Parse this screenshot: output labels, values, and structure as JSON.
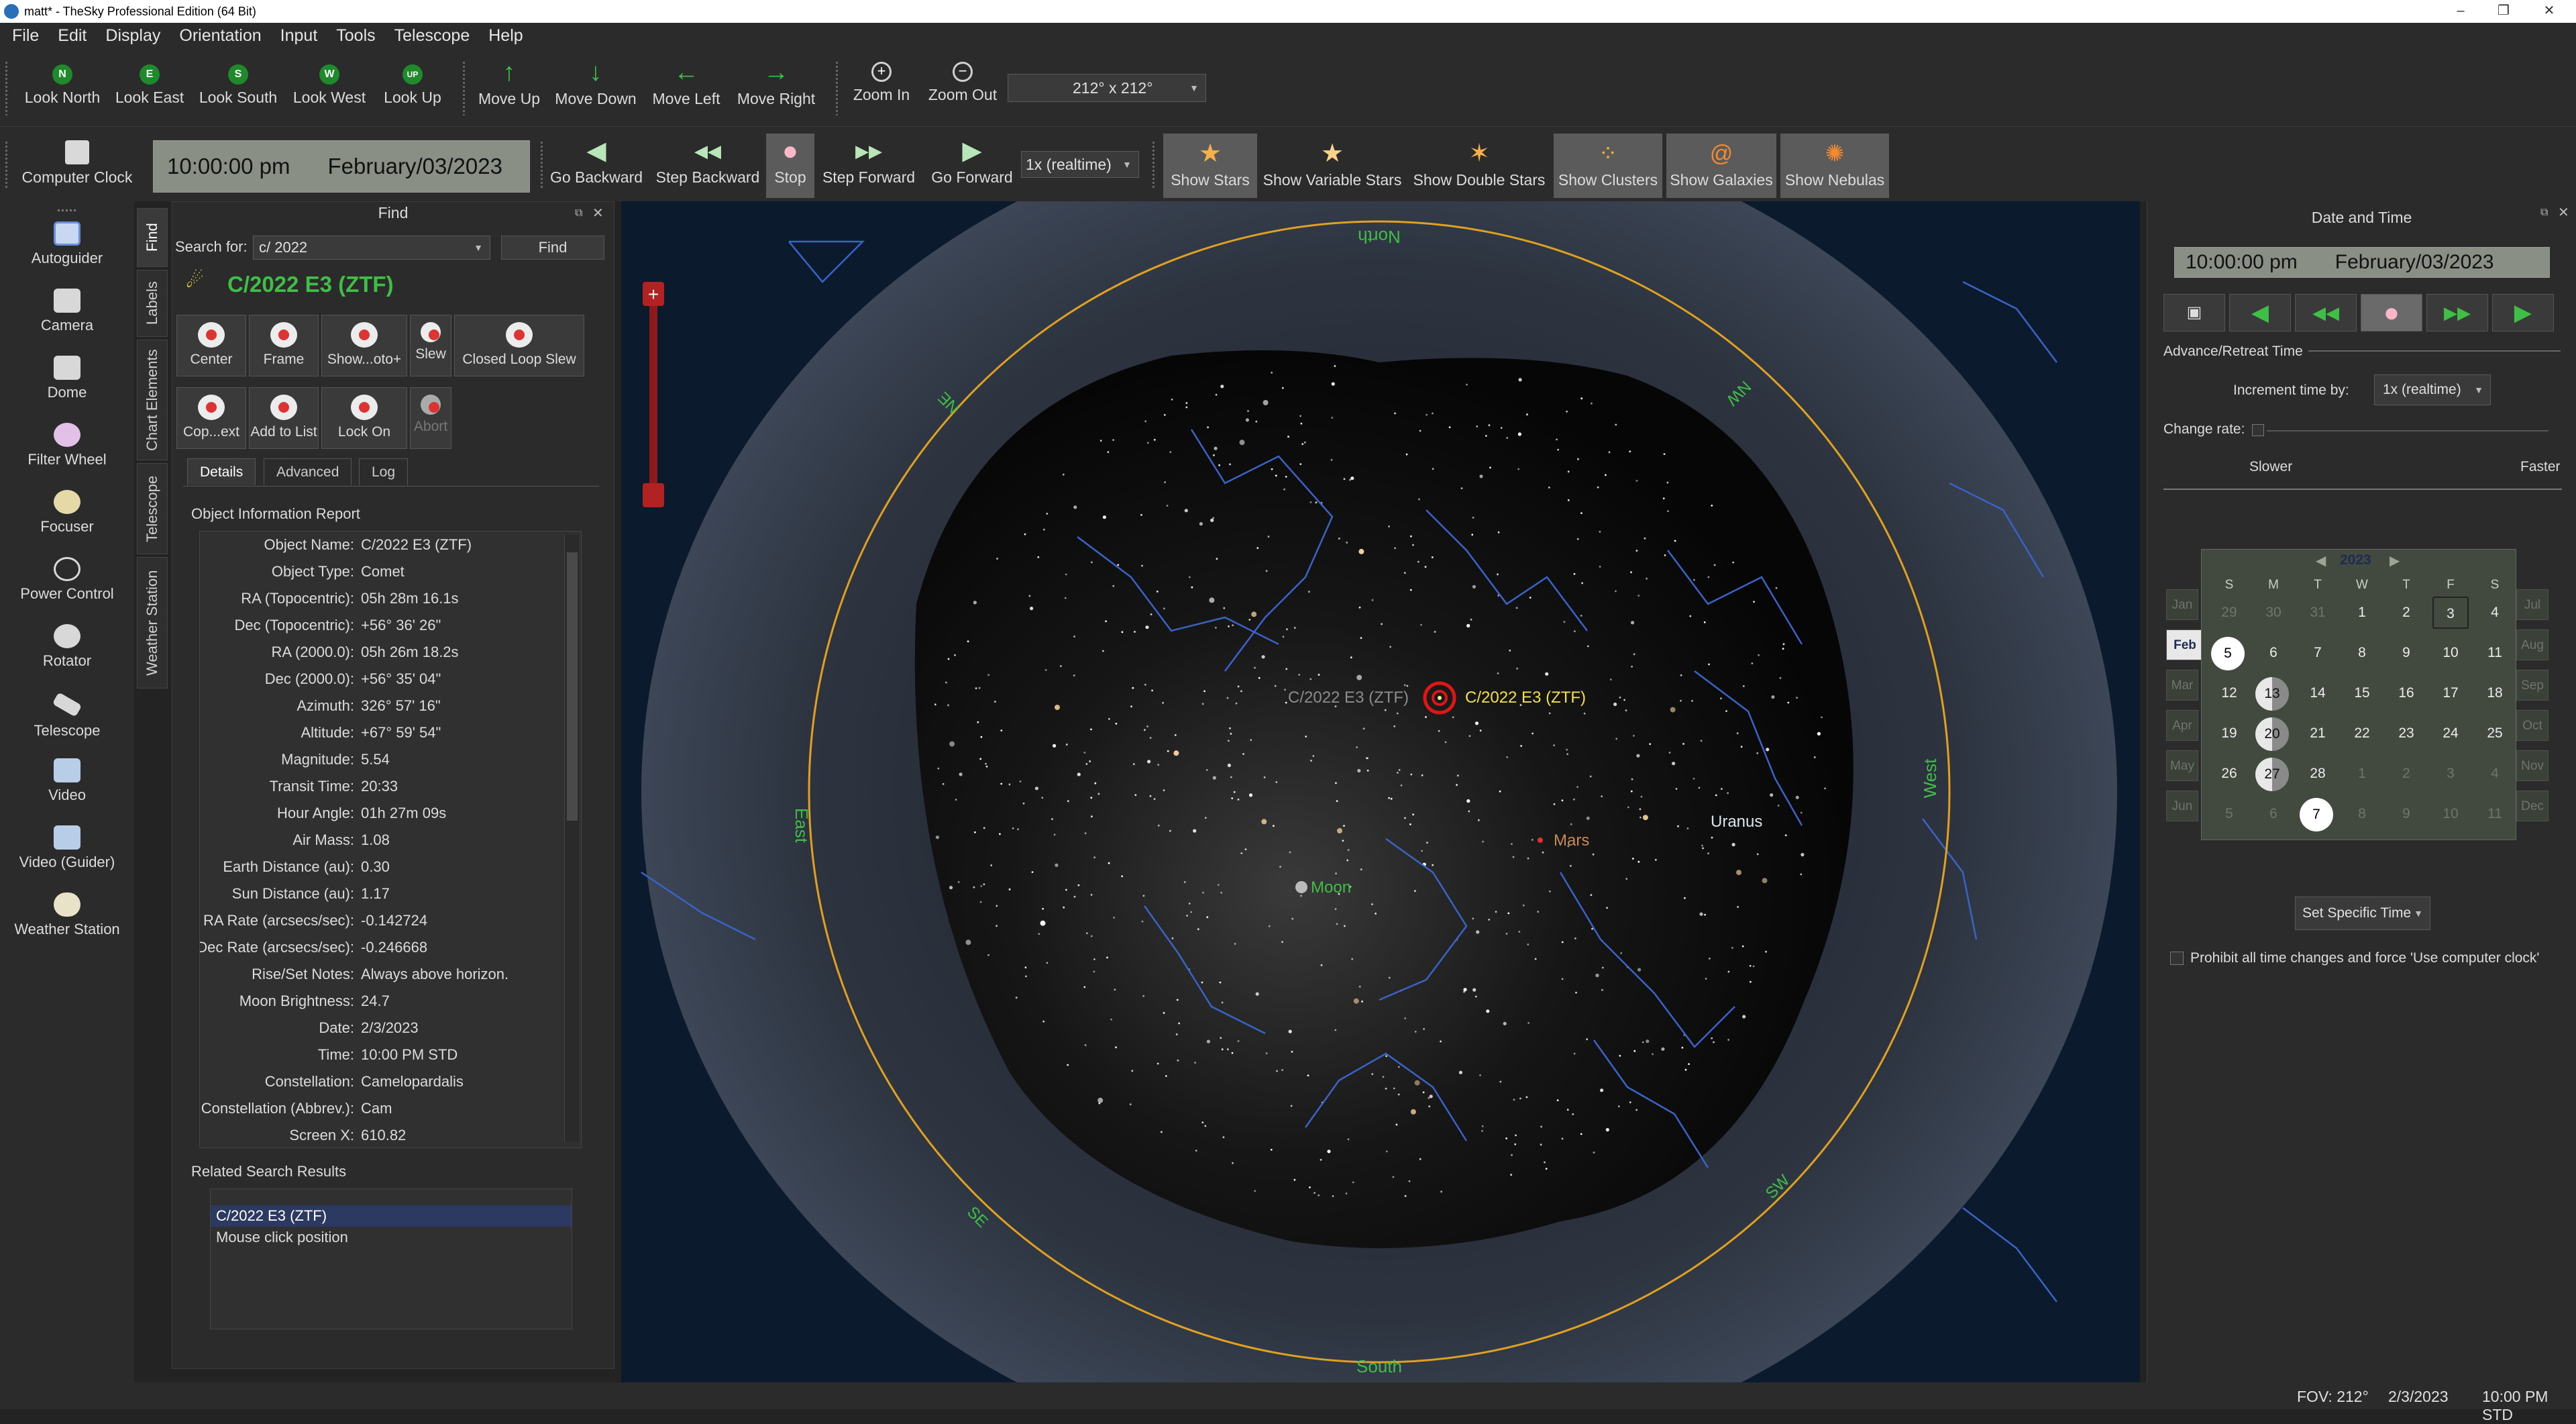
{
  "window": {
    "title": "matt* - TheSky Professional Edition (64 Bit)",
    "controls": [
      "–",
      "❐",
      "✕"
    ]
  },
  "menu": [
    "File",
    "Edit",
    "Display",
    "Orientation",
    "Input",
    "Tools",
    "Telescope",
    "Help"
  ],
  "toolbar1": {
    "look": [
      {
        "icon": "N",
        "label": "Look North"
      },
      {
        "icon": "E",
        "label": "Look East"
      },
      {
        "icon": "S",
        "label": "Look South"
      },
      {
        "icon": "W",
        "label": "Look West"
      },
      {
        "icon": "UP",
        "label": "Look Up"
      }
    ],
    "move": [
      {
        "icon": "↑",
        "label": "Move Up"
      },
      {
        "icon": "↓",
        "label": "Move Down"
      },
      {
        "icon": "←",
        "label": "Move Left"
      },
      {
        "icon": "→",
        "label": "Move Right"
      }
    ],
    "zoom": [
      {
        "icon": "+",
        "label": "Zoom In"
      },
      {
        "icon": "−",
        "label": "Zoom Out"
      }
    ],
    "fov_select": "212° x 212°"
  },
  "toolbar2": {
    "computer_clock": "Computer Clock",
    "time": "10:00:00 pm",
    "date": "February/03/2023",
    "steps": [
      {
        "icon": "◀",
        "label": "Go Backward"
      },
      {
        "icon": "◀◀",
        "label": "Step Backward"
      },
      {
        "icon": "●",
        "label": "Stop"
      },
      {
        "icon": "▶▶",
        "label": "Step Forward"
      },
      {
        "icon": "▶",
        "label": "Go Forward"
      }
    ],
    "rate": "1x (realtime)",
    "shows": [
      {
        "label": "Show Stars",
        "active": true
      },
      {
        "label": "Show Variable Stars",
        "active": false
      },
      {
        "label": "Show Double Stars",
        "active": false
      },
      {
        "label": "Show Clusters",
        "active": true
      },
      {
        "label": "Show Galaxies",
        "active": true
      },
      {
        "label": "Show Nebulas",
        "active": true
      }
    ]
  },
  "leftbar": [
    "Autoguider",
    "Camera",
    "Dome",
    "Filter Wheel",
    "Focuser",
    "Power Control",
    "Rotator",
    "Telescope",
    "Video",
    "Video (Guider)",
    "Weather Station"
  ],
  "vtabs": [
    "Find",
    "Labels",
    "Chart Elements",
    "Telescope",
    "Weather Station"
  ],
  "find": {
    "title": "Find",
    "search_label": "Search for:",
    "search_value": "c/ 2022",
    "find_button": "Find",
    "object_title": "C/2022 E3 (ZTF)",
    "actions": [
      "Center",
      "Frame",
      "Show...oto+",
      "Slew",
      "Closed Loop Slew",
      "Cop...ext",
      "Add to List",
      "Lock On",
      "Abort"
    ],
    "tabs": [
      "Details",
      "Advanced",
      "Log"
    ],
    "report_title": "Object Information Report",
    "rows": [
      [
        "Object Name:",
        "C/2022 E3 (ZTF)"
      ],
      [
        "Object Type:",
        "Comet"
      ],
      [
        "RA (Topocentric):",
        "05h 28m 16.1s"
      ],
      [
        "Dec (Topocentric):",
        "+56° 36' 26\""
      ],
      [
        "RA (2000.0):",
        "05h 26m 18.2s"
      ],
      [
        "Dec (2000.0):",
        "+56° 35' 04\""
      ],
      [
        "Azimuth:",
        "326° 57' 16\""
      ],
      [
        "Altitude:",
        "+67° 59' 54\""
      ],
      [
        "Magnitude:",
        "5.54"
      ],
      [
        "Transit Time:",
        "20:33"
      ],
      [
        "Hour Angle:",
        "01h 27m 09s"
      ],
      [
        "Air Mass:",
        "1.08"
      ],
      [
        "Earth Distance (au):",
        "0.30"
      ],
      [
        "Sun Distance (au):",
        "1.17"
      ],
      [
        "RA Rate (arcsecs/sec):",
        "-0.142724"
      ],
      [
        "Dec Rate (arcsecs/sec):",
        "-0.246668"
      ],
      [
        "Rise/Set Notes:",
        "Always above horizon."
      ],
      [
        "Moon Brightness:",
        "24.7"
      ],
      [
        "Date:",
        "2/3/2023"
      ],
      [
        "Time:",
        "10:00 PM STD"
      ],
      [
        "Constellation:",
        "Camelopardalis"
      ],
      [
        "Constellation (Abbrev.):",
        "Cam"
      ],
      [
        "Screen X:",
        "610.82"
      ]
    ],
    "related_title": "Related Search Results",
    "related": [
      "C/2022 E3 (ZTF)",
      "Mouse click position"
    ]
  },
  "sky": {
    "directions": {
      "north": "North",
      "south": "South",
      "east": "East",
      "west": "West",
      "ne": "NE",
      "nw": "NW",
      "se": "SE",
      "sw": "SW"
    },
    "labels": {
      "comet_ghost": "C/2022 E3 (ZTF)",
      "comet": "C/2022 E3 (ZTF)",
      "mars": "Mars",
      "uranus": "Uranus",
      "moon": "Moon"
    }
  },
  "datetime": {
    "title": "Date and Time",
    "time": "10:00:00 pm",
    "date": "February/03/2023",
    "advance_label": "Advance/Retreat Time",
    "increment_label": "Increment time by:",
    "increment_value": "1x (realtime)",
    "change_rate_label": "Change rate:",
    "slower": "Slower",
    "faster": "Faster",
    "calendar": {
      "year": "2023",
      "weekdays": [
        "S",
        "M",
        "T",
        "W",
        "T",
        "F",
        "S"
      ],
      "left_months": [
        "Jan",
        "Feb",
        "Mar",
        "Apr",
        "May",
        "Jun"
      ],
      "right_months": [
        "Jul",
        "Aug",
        "Sep",
        "Oct",
        "Nov",
        "Dec"
      ],
      "weeks": [
        [
          "29",
          "30",
          "31",
          "1",
          "2",
          "3",
          "4"
        ],
        [
          "5",
          "6",
          "7",
          "8",
          "9",
          "10",
          "11"
        ],
        [
          "12",
          "13",
          "14",
          "15",
          "16",
          "17",
          "18"
        ],
        [
          "19",
          "20",
          "21",
          "22",
          "23",
          "24",
          "25"
        ],
        [
          "26",
          "27",
          "28",
          "1",
          "2",
          "3",
          "4"
        ],
        [
          "5",
          "6",
          "7",
          "8",
          "9",
          "10",
          "11"
        ]
      ]
    },
    "set_specific": "Set Specific Time",
    "prohibit_label": "Prohibit all time changes and force 'Use computer clock'"
  },
  "status": {
    "fov": "FOV: 212°",
    "date": "2/3/2023",
    "time": "10:00 PM STD"
  },
  "colors": {
    "accent_green": "#3fbf45",
    "horizon_ring": "#e0a020",
    "constellation_lines": "#3a63c8",
    "comet_red": "#e01515"
  }
}
